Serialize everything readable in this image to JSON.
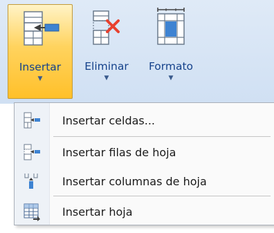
{
  "ribbon": {
    "buttons": [
      {
        "label": "Insertar",
        "icon": "insert-cells-icon",
        "active": true
      },
      {
        "label": "Eliminar",
        "icon": "delete-cells-icon",
        "active": false
      },
      {
        "label": "Formato",
        "icon": "format-cells-icon",
        "active": false
      }
    ]
  },
  "menu": {
    "items": [
      {
        "label": "Insertar celdas...",
        "icon": "insert-cells-icon"
      },
      {
        "label": "Insertar filas de hoja",
        "icon": "insert-rows-icon"
      },
      {
        "label": "Insertar columnas de hoja",
        "icon": "insert-columns-icon"
      },
      {
        "label": "Insertar hoja",
        "icon": "insert-sheet-icon"
      }
    ]
  },
  "colors": {
    "active_button": "#ffc02a",
    "ribbon_bg": "#d0e0f3",
    "ribbon_text": "#15428b",
    "delete_x": "#e8412f"
  }
}
